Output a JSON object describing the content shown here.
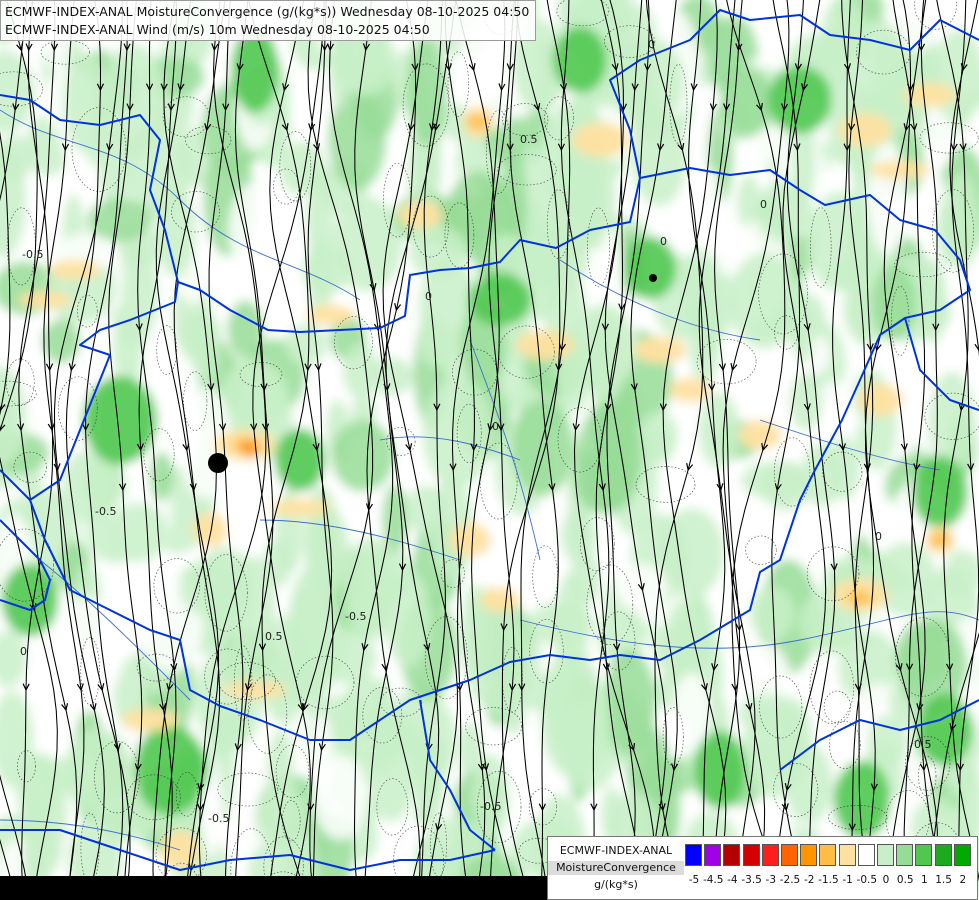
{
  "title": {
    "line1": "ECMWF-INDEX-ANAL MoistureConvergence (g/(kg*s)) Wednesday 08-10-2025 04:50",
    "line2": "ECMWF-INDEX-ANAL Wind (m/s) 10m Wednesday 08-10-2025 04:50"
  },
  "legend": {
    "name_line1": "ECMWF-INDEX-ANAL",
    "name_line2": "MoistureConvergence",
    "unit": "g/(kg*s)",
    "colors": [
      "#0000ff",
      "#a000e6",
      "#b40000",
      "#d20000",
      "#ff1e1e",
      "#ff6400",
      "#ff9600",
      "#ffbe46",
      "#ffe0a0",
      "#ffffff",
      "#c8f0c8",
      "#96dc96",
      "#50c850",
      "#1eaa1e",
      "#00aa00"
    ],
    "ticks": [
      "-5",
      "-4.5",
      "-4",
      "-3.5",
      "-3",
      "-2.5",
      "-2",
      "-1.5",
      "-1",
      "-0.5",
      "0",
      "0.5",
      "1",
      "1.5",
      "2"
    ]
  },
  "map": {
    "contour_labels": [
      "0",
      "-0.5",
      "0.5"
    ],
    "colors": {
      "border": "#0033dd",
      "rivers": "#3f6fcf",
      "streamline": "#000000",
      "contour": "#222222"
    }
  }
}
